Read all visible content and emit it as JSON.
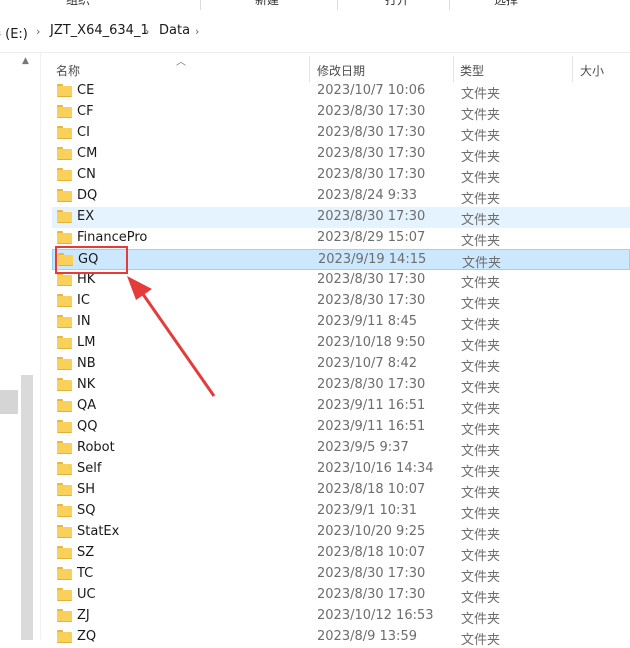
{
  "ribbon": {
    "groups": [
      "组织",
      "新建",
      "打开",
      "选择"
    ]
  },
  "address": {
    "segments": [
      "卷 (E:)",
      "JZT_X64_634_1",
      "Data"
    ],
    "separator": "›"
  },
  "columns": {
    "name": "名称",
    "date": "修改日期",
    "type": "类型",
    "size": "大小",
    "sort": "ascending"
  },
  "selected": "GQ",
  "hovered": "EX",
  "files": [
    {
      "name": "CE",
      "date": "2023/10/7 10:06",
      "type": "文件夹"
    },
    {
      "name": "CF",
      "date": "2023/8/30 17:30",
      "type": "文件夹"
    },
    {
      "name": "CI",
      "date": "2023/8/30 17:30",
      "type": "文件夹"
    },
    {
      "name": "CM",
      "date": "2023/8/30 17:30",
      "type": "文件夹"
    },
    {
      "name": "CN",
      "date": "2023/8/30 17:30",
      "type": "文件夹"
    },
    {
      "name": "DQ",
      "date": "2023/8/24 9:33",
      "type": "文件夹"
    },
    {
      "name": "EX",
      "date": "2023/8/30 17:30",
      "type": "文件夹"
    },
    {
      "name": "FinancePro",
      "date": "2023/8/29 15:07",
      "type": "文件夹"
    },
    {
      "name": "GQ",
      "date": "2023/9/19 14:15",
      "type": "文件夹"
    },
    {
      "name": "HK",
      "date": "2023/8/30 17:30",
      "type": "文件夹"
    },
    {
      "name": "IC",
      "date": "2023/8/30 17:30",
      "type": "文件夹"
    },
    {
      "name": "IN",
      "date": "2023/9/11 8:45",
      "type": "文件夹"
    },
    {
      "name": "LM",
      "date": "2023/10/18 9:50",
      "type": "文件夹"
    },
    {
      "name": "NB",
      "date": "2023/10/7 8:42",
      "type": "文件夹"
    },
    {
      "name": "NK",
      "date": "2023/8/30 17:30",
      "type": "文件夹"
    },
    {
      "name": "QA",
      "date": "2023/9/11 16:51",
      "type": "文件夹"
    },
    {
      "name": "QQ",
      "date": "2023/9/11 16:51",
      "type": "文件夹"
    },
    {
      "name": "Robot",
      "date": "2023/9/5 9:37",
      "type": "文件夹"
    },
    {
      "name": "Self",
      "date": "2023/10/16 14:34",
      "type": "文件夹"
    },
    {
      "name": "SH",
      "date": "2023/8/18 10:07",
      "type": "文件夹"
    },
    {
      "name": "SQ",
      "date": "2023/9/1 10:31",
      "type": "文件夹"
    },
    {
      "name": "StatEx",
      "date": "2023/10/20 9:25",
      "type": "文件夹"
    },
    {
      "name": "SZ",
      "date": "2023/8/18 10:07",
      "type": "文件夹"
    },
    {
      "name": "TC",
      "date": "2023/8/30 17:30",
      "type": "文件夹"
    },
    {
      "name": "UC",
      "date": "2023/8/30 17:30",
      "type": "文件夹"
    },
    {
      "name": "ZJ",
      "date": "2023/10/12 16:53",
      "type": "文件夹"
    },
    {
      "name": "ZQ",
      "date": "2023/8/9 13:59",
      "type": "文件夹"
    }
  ],
  "annotation": {
    "color": "#e63b3b"
  }
}
